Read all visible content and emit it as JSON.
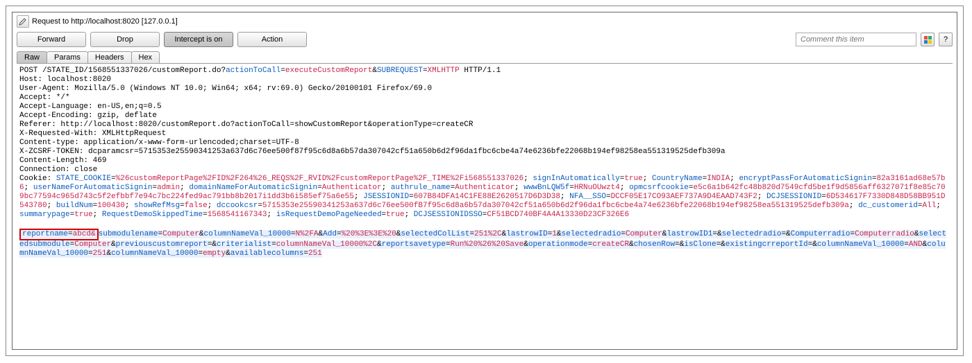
{
  "header": {
    "request_label": "Request to http://localhost:8020  [127.0.0.1]"
  },
  "toolbar": {
    "forward": "Forward",
    "drop": "Drop",
    "intercept": "Intercept is on",
    "action": "Action",
    "comment_placeholder": "Comment this item",
    "help": "?"
  },
  "tabs": {
    "raw": "Raw",
    "params": "Params",
    "headers": "Headers",
    "hex": "Hex"
  },
  "req": {
    "line1_pre": "POST /STATE_ID/1568551337026/customReport.do?",
    "line1_k1": "actionToCall",
    "line1_v1": "executeCustomReport",
    "line1_k2": "SUBREQUEST",
    "line1_v2": "XMLHTTP",
    "line1_post": " HTTP/1.1",
    "host": "Host: localhost:8020",
    "ua": "User-Agent: Mozilla/5.0 (Windows NT 10.0; Win64; x64; rv:69.0) Gecko/20100101 Firefox/69.0",
    "accept": "Accept: */*",
    "accept_lang": "Accept-Language: en-US,en;q=0.5",
    "accept_enc": "Accept-Encoding: gzip, deflate",
    "referer": "Referer: http://localhost:8020/customReport.do?actionToCall=showCustomReport&operationType=createCR",
    "xreq": "X-Requested-With: XMLHttpRequest",
    "ctype": "Content-type: application/x-www-form-urlencoded;charset=UTF-8",
    "xcsrf": "X-ZCSRF-TOKEN: dcparamcsr=5715353e25590341253a637d6c76ee500f87f95c6d8a6b57da307042cf51a650b6d2f96da1fbc6cbe4a74e6236bfe22068b194ef98258ea551319525defb309a",
    "clen": "Content-Length: 469",
    "conn": "Connection: close",
    "cookie_pre": "Cookie: ",
    "cookie_pairs": [
      {
        "k": "STATE_COOKIE",
        "v": "%26customReportPage%2FID%2F264%26_REQS%2F_RVID%2FcustomReportPage%2F_TIME%2Fi568551337026"
      },
      {
        "k": "signInAutomatically",
        "v": "true"
      },
      {
        "k": "CountryName",
        "v": "INDIA"
      },
      {
        "k": "encryptPassForAutomaticSignin",
        "v": "82a3161ad68e57b6"
      },
      {
        "k": "userNameForAutomaticSignin",
        "v": "admin"
      },
      {
        "k": "domainNameForAutomaticSignin",
        "v": "Authenticator"
      },
      {
        "k": "authrule_name",
        "v": "Authenticator"
      },
      {
        "k": "wwwBnLQW5f",
        "v": "HRNuOUwzt4"
      },
      {
        "k": "opmcsrfcookie",
        "v": "e5c6a1b642fc48b820d7549cfd5be1f9d5856aff6327071f8e85c709bc77594c965d743c5f2efbbf7e94c7bc224fed9ac791bb8b2017i1dd3b6i585ef75a6e55"
      },
      {
        "k": "JSESSIONID",
        "v": "607B84DFA14C1FE88E2620517D6D3D38"
      },
      {
        "k": "NFA__SSO",
        "v": "DCCF05E17CO93AEF737A9D4EAAD743F2"
      },
      {
        "k": "DCJSESSIONID",
        "v": "6D534617F7330D848D58BB951D543780"
      },
      {
        "k": "buildNum",
        "v": "100430"
      },
      {
        "k": "showRefMsg",
        "v": "false"
      },
      {
        "k": "dccookcsr",
        "v": "5715353e25590341253a637d6c76ee500fB7f95c6d8a6b57da307042cf51a650b6d2f96da1fbc6cbe4a74e6236bfe22068b194ef98258ea551319525defb309a"
      },
      {
        "k": "dc_customerid",
        "v": "All"
      },
      {
        "k": "summarypage",
        "v": "true"
      },
      {
        "k": "RequestDemoSkippedTime",
        "v": "1568541167343"
      },
      {
        "k": "isRequestDemoPageNeeded",
        "v": "true"
      },
      {
        "k": "DCJSESSIONIDSSO",
        "v": "CF51BCD740BF4A4A13330D23CF326E6"
      }
    ],
    "body_highlight_k": "reportname",
    "body_highlight_v": "abcd&",
    "body_pairs": [
      {
        "k": "submodulename",
        "v": "Computer"
      },
      {
        "k": "columnNameVal_10000",
        "v": "N%2FA"
      },
      {
        "k": "Add",
        "v": "%20%3E%3E%20"
      },
      {
        "k": "selectedColList",
        "v": "251%2C"
      },
      {
        "k": "lastrowID",
        "v": "1"
      },
      {
        "k": "selectedradio",
        "v": "Computer"
      },
      {
        "k": "lastrowID1",
        "v": ""
      },
      {
        "k": "selectedradio",
        "v": ""
      },
      {
        "k": "Computerradio",
        "v": "Computerradio"
      },
      {
        "k": "selectedsubmodule",
        "v": "Computer"
      },
      {
        "k": "previouscustomreport",
        "v": ""
      },
      {
        "k": "criterialist",
        "v": "columnNameVal_10000%2C"
      },
      {
        "k": "reportsavetype",
        "v": "Run%20%26%20Save"
      },
      {
        "k": "operationmode",
        "v": "createCR"
      },
      {
        "k": "chosenRow",
        "v": ""
      },
      {
        "k": "isClone",
        "v": ""
      },
      {
        "k": "existingcrreportId",
        "v": ""
      },
      {
        "k": "columnNameVal_10000",
        "v": "AND"
      },
      {
        "k": "columnNameVal_10000",
        "v": "251"
      },
      {
        "k": "columnNameVal_10000",
        "v": "empty"
      },
      {
        "k": "availablecolumns",
        "v": "251"
      }
    ]
  }
}
